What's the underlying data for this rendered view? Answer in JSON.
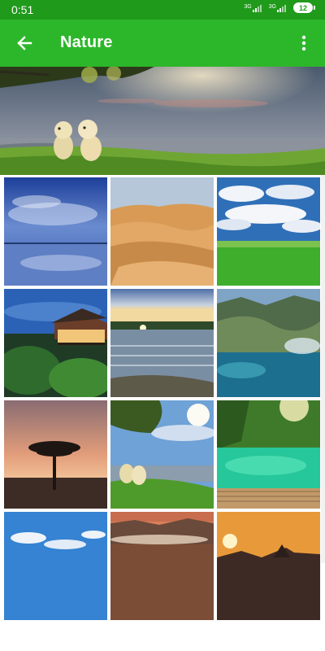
{
  "status": {
    "time": "0:51",
    "net1": "3G",
    "net2": "3G",
    "battery": "12"
  },
  "appbar": {
    "title": "Nature",
    "back_icon": "arrow-left-icon",
    "more_icon": "more-vert-icon"
  },
  "colors": {
    "status_bar": "#1f9a1a",
    "app_bar": "#2cb72a"
  },
  "hero": {
    "image": "puppies-on-grass-by-sea"
  },
  "wallpapers": [
    {
      "image": "blue-sky-clouds-reflection"
    },
    {
      "image": "desert-sand-dunes"
    },
    {
      "image": "clouds-over-green-field"
    },
    {
      "image": "pagoda-house-at-dusk"
    },
    {
      "image": "lake-shore-sunset"
    },
    {
      "image": "coastal-mountain-lagoon"
    },
    {
      "image": "acacia-tree-savanna-sunset"
    },
    {
      "image": "puppies-tree-seaside"
    },
    {
      "image": "turquoise-pool-waterfall-boardwalk"
    },
    {
      "image": "blue-sky-white-clouds"
    },
    {
      "image": "mountain-valley-sunset"
    },
    {
      "image": "orange-sunset-mountains"
    }
  ]
}
